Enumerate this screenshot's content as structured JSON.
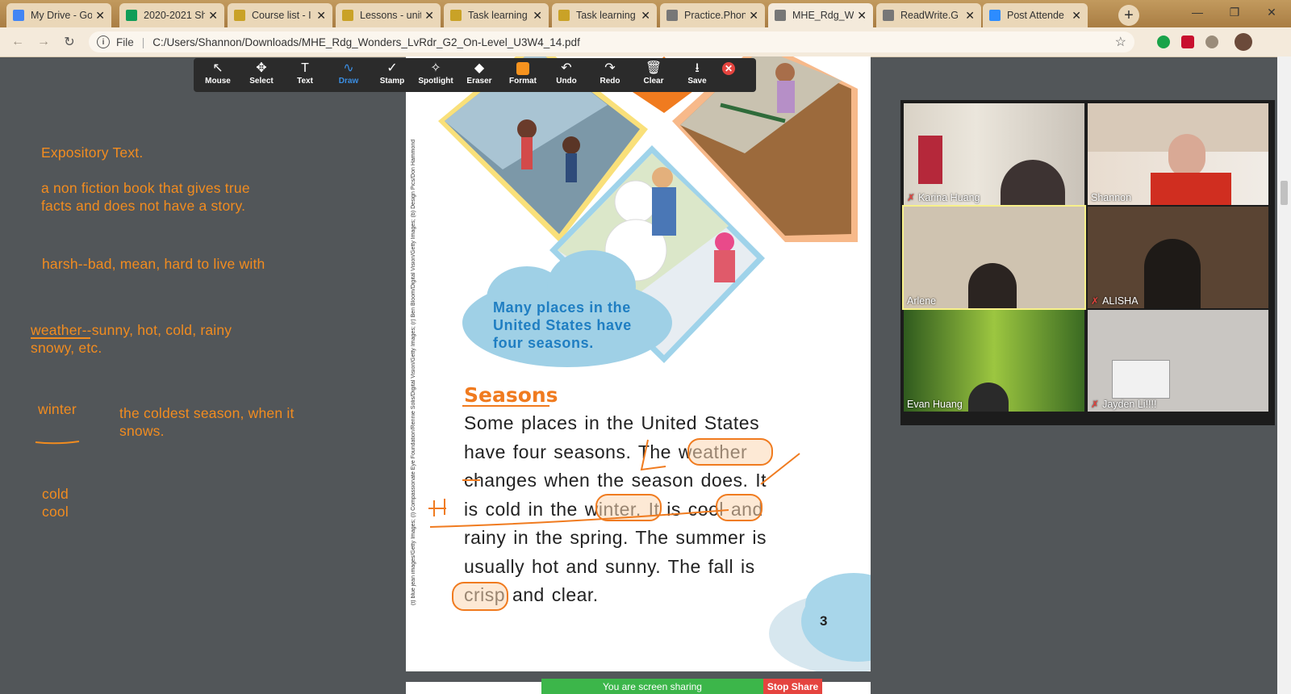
{
  "browser": {
    "tabs": [
      {
        "label": "My Drive - Go",
        "icon_color": "#4285f4"
      },
      {
        "label": "2020-2021 Sh",
        "icon_color": "#0f9d58"
      },
      {
        "label": "Course list - I",
        "icon_color": "#c9a227"
      },
      {
        "label": "Lessons - unit",
        "icon_color": "#c9a227"
      },
      {
        "label": "Task learning",
        "icon_color": "#c9a227"
      },
      {
        "label": "Task learning",
        "icon_color": "#c9a227"
      },
      {
        "label": "Practice.Phon",
        "icon_color": "#777777"
      },
      {
        "label": "MHE_Rdg_W",
        "icon_color": "#777777"
      },
      {
        "label": "ReadWrite.G",
        "icon_color": "#777777"
      },
      {
        "label": "Post Attende",
        "icon_color": "#2d8cff"
      }
    ],
    "active_tab_index": 7,
    "address": {
      "scheme": "File",
      "url": "C:/Users/Shannon/Downloads/MHE_Rdg_Wonders_LvRdr_G2_On-Level_U3W4_14.pdf"
    }
  },
  "annotation_toolbar": {
    "tools": [
      {
        "label": "Mouse",
        "icon": "cursor-icon"
      },
      {
        "label": "Select",
        "icon": "move-icon"
      },
      {
        "label": "Text",
        "icon": "text-icon"
      },
      {
        "label": "Draw",
        "icon": "draw-icon"
      },
      {
        "label": "Stamp",
        "icon": "check-icon"
      },
      {
        "label": "Spotlight",
        "icon": "spotlight-icon"
      },
      {
        "label": "Eraser",
        "icon": "eraser-icon"
      },
      {
        "label": "Format",
        "icon": "format-icon"
      },
      {
        "label": "Undo",
        "icon": "undo-icon"
      },
      {
        "label": "Redo",
        "icon": "redo-icon"
      },
      {
        "label": "Clear",
        "icon": "trash-icon"
      },
      {
        "label": "Save",
        "icon": "save-icon"
      }
    ],
    "active_tool": "Draw",
    "format_color": "#f7931e"
  },
  "notes": {
    "n1": "Expository Text.",
    "n2a": "a non fiction book that gives true",
    "n2b": "facts and does not have a story.",
    "n3": "harsh--bad, mean, hard to live with",
    "n4a": "weather--sunny, hot, cold, rainy",
    "n4b": "snowy, etc.",
    "n5": "winter",
    "n6a": "the coldest season, when it",
    "n6b": "snows.",
    "n7a": "cold",
    "n7b": "cool"
  },
  "pdf": {
    "cloud_caption": "Many places in the United States have four seasons.",
    "heading": "Seasons",
    "body_lines": [
      "Some places in the United States",
      "have four seasons. The weather",
      "changes when the season does. It",
      "is cold in the winter. It is cool and",
      "rainy in the spring. The summer is",
      "usually hot and sunny. The fall is",
      "crisp and clear."
    ],
    "page_number": "3",
    "credit": "(t) blue jean images/Getty Images; (l) Compassionate Eye Foundation/Rennie Solis/Digital Vision/Getty Images; (r) Ben Bloom/Digital Vision/Getty Images; (b) Design Pics/Don Hammond"
  },
  "participants": [
    {
      "name": "Karina Huang",
      "muted": true
    },
    {
      "name": "Shannon",
      "muted": false
    },
    {
      "name": "Arlene",
      "muted": false
    },
    {
      "name": "ALISHA",
      "muted": true
    },
    {
      "name": "Evan Huang",
      "muted": false
    },
    {
      "name": "Jayden Li!!!!",
      "muted": true
    }
  ],
  "share_bar": {
    "status": "You are screen sharing",
    "stop_label": "Stop Share"
  },
  "colors": {
    "annotation_orange": "#f28c1f",
    "heading_orange": "#f07b1f",
    "cloud_blue": "#1f7ec2",
    "share_green": "#3cb64a",
    "stop_red": "#e5443f"
  }
}
